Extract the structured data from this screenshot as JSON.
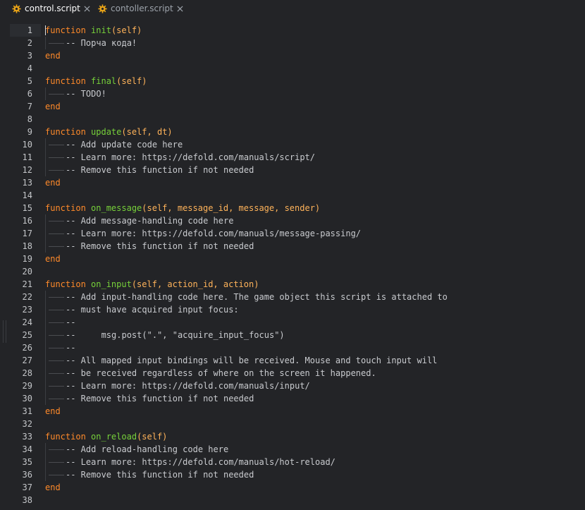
{
  "tabs": [
    {
      "label": "control.script",
      "active": true,
      "icon": "gear-icon"
    },
    {
      "label": "contoller.script",
      "active": false,
      "icon": "gear-icon"
    }
  ],
  "colors": {
    "background": "#232427",
    "keyword": "#ff8a2a",
    "function_name": "#77d13a",
    "param": "#ffb35a",
    "comment": "#c9cbcf",
    "gear": "#e8a317"
  },
  "editor": {
    "lines": [
      {
        "n": "1",
        "tokens": [
          {
            "t": "function ",
            "c": "kw"
          },
          {
            "t": "init",
            "c": "fn"
          },
          {
            "t": "(self)",
            "c": "pm"
          }
        ]
      },
      {
        "n": "2",
        "indent": true,
        "tokens": [
          {
            "t": "-- Порча кода!",
            "c": "cm"
          }
        ]
      },
      {
        "n": "3",
        "tokens": [
          {
            "t": "end",
            "c": "kw"
          }
        ]
      },
      {
        "n": "4",
        "tokens": []
      },
      {
        "n": "5",
        "tokens": [
          {
            "t": "function ",
            "c": "kw"
          },
          {
            "t": "final",
            "c": "fn"
          },
          {
            "t": "(self)",
            "c": "pm"
          }
        ]
      },
      {
        "n": "6",
        "indent": true,
        "tokens": [
          {
            "t": "-- TODO!",
            "c": "cm"
          }
        ]
      },
      {
        "n": "7",
        "tokens": [
          {
            "t": "end",
            "c": "kw"
          }
        ]
      },
      {
        "n": "8",
        "tokens": []
      },
      {
        "n": "9",
        "tokens": [
          {
            "t": "function ",
            "c": "kw"
          },
          {
            "t": "update",
            "c": "fn"
          },
          {
            "t": "(self, dt)",
            "c": "pm"
          }
        ]
      },
      {
        "n": "10",
        "indent": true,
        "tokens": [
          {
            "t": "-- Add update code here",
            "c": "cm"
          }
        ]
      },
      {
        "n": "11",
        "indent": true,
        "tokens": [
          {
            "t": "-- Learn more: https://defold.com/manuals/script/",
            "c": "cm"
          }
        ]
      },
      {
        "n": "12",
        "indent": true,
        "tokens": [
          {
            "t": "-- Remove this function if not needed",
            "c": "cm"
          }
        ]
      },
      {
        "n": "13",
        "tokens": [
          {
            "t": "end",
            "c": "kw"
          }
        ]
      },
      {
        "n": "14",
        "tokens": []
      },
      {
        "n": "15",
        "tokens": [
          {
            "t": "function ",
            "c": "kw"
          },
          {
            "t": "on_message",
            "c": "fn"
          },
          {
            "t": "(self, message_id, message, sender)",
            "c": "pm"
          }
        ]
      },
      {
        "n": "16",
        "indent": true,
        "tokens": [
          {
            "t": "-- Add message-handling code here",
            "c": "cm"
          }
        ]
      },
      {
        "n": "17",
        "indent": true,
        "tokens": [
          {
            "t": "-- Learn more: https://defold.com/manuals/message-passing/",
            "c": "cm"
          }
        ]
      },
      {
        "n": "18",
        "indent": true,
        "tokens": [
          {
            "t": "-- Remove this function if not needed",
            "c": "cm"
          }
        ]
      },
      {
        "n": "19",
        "tokens": [
          {
            "t": "end",
            "c": "kw"
          }
        ]
      },
      {
        "n": "20",
        "tokens": []
      },
      {
        "n": "21",
        "tokens": [
          {
            "t": "function ",
            "c": "kw"
          },
          {
            "t": "on_input",
            "c": "fn"
          },
          {
            "t": "(self, action_id, action)",
            "c": "pm"
          }
        ]
      },
      {
        "n": "22",
        "indent": true,
        "tokens": [
          {
            "t": "-- Add input-handling code here. The game object this script is attached to",
            "c": "cm"
          }
        ]
      },
      {
        "n": "23",
        "indent": true,
        "tokens": [
          {
            "t": "-- must have acquired input focus:",
            "c": "cm"
          }
        ]
      },
      {
        "n": "24",
        "indent": true,
        "tokens": [
          {
            "t": "--",
            "c": "cm"
          }
        ]
      },
      {
        "n": "25",
        "indent": true,
        "tokens": [
          {
            "t": "--     msg.post(\".\", \"acquire_input_focus\")",
            "c": "cm"
          }
        ]
      },
      {
        "n": "26",
        "indent": true,
        "tokens": [
          {
            "t": "--",
            "c": "cm"
          }
        ]
      },
      {
        "n": "27",
        "indent": true,
        "tokens": [
          {
            "t": "-- All mapped input bindings will be received. Mouse and touch input will",
            "c": "cm"
          }
        ]
      },
      {
        "n": "28",
        "indent": true,
        "tokens": [
          {
            "t": "-- be received regardless of where on the screen it happened.",
            "c": "cm"
          }
        ]
      },
      {
        "n": "29",
        "indent": true,
        "tokens": [
          {
            "t": "-- Learn more: https://defold.com/manuals/input/",
            "c": "cm"
          }
        ]
      },
      {
        "n": "30",
        "indent": true,
        "tokens": [
          {
            "t": "-- Remove this function if not needed",
            "c": "cm"
          }
        ]
      },
      {
        "n": "31",
        "tokens": [
          {
            "t": "end",
            "c": "kw"
          }
        ]
      },
      {
        "n": "32",
        "tokens": []
      },
      {
        "n": "33",
        "tokens": [
          {
            "t": "function ",
            "c": "kw"
          },
          {
            "t": "on_reload",
            "c": "fn"
          },
          {
            "t": "(self)",
            "c": "pm"
          }
        ]
      },
      {
        "n": "34",
        "indent": true,
        "tokens": [
          {
            "t": "-- Add reload-handling code here",
            "c": "cm"
          }
        ]
      },
      {
        "n": "35",
        "indent": true,
        "tokens": [
          {
            "t": "-- Learn more: https://defold.com/manuals/hot-reload/",
            "c": "cm"
          }
        ]
      },
      {
        "n": "36",
        "indent": true,
        "tokens": [
          {
            "t": "-- Remove this function if not needed",
            "c": "cm"
          }
        ]
      },
      {
        "n": "37",
        "tokens": [
          {
            "t": "end",
            "c": "kw"
          }
        ]
      },
      {
        "n": "38",
        "tokens": []
      }
    ]
  }
}
